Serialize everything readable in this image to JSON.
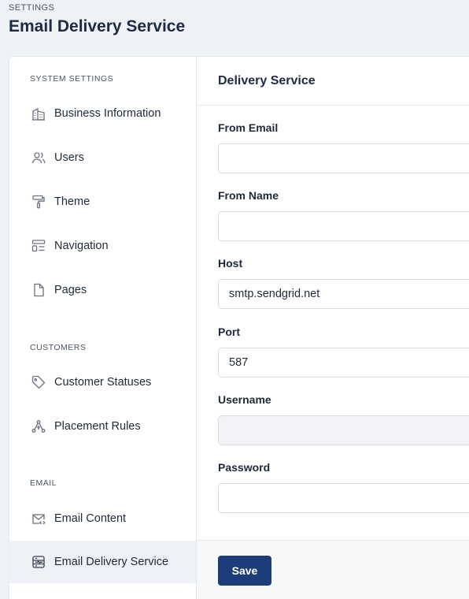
{
  "header": {
    "eyebrow": "SETTINGS",
    "title": "Email Delivery Service"
  },
  "sidebar": {
    "sections": [
      {
        "title": "SYSTEM SETTINGS",
        "items": [
          {
            "label": "Business Information",
            "icon": "building-icon"
          },
          {
            "label": "Users",
            "icon": "users-icon"
          },
          {
            "label": "Theme",
            "icon": "paint-roller-icon"
          },
          {
            "label": "Navigation",
            "icon": "layout-icon"
          },
          {
            "label": "Pages",
            "icon": "file-icon"
          }
        ]
      },
      {
        "title": "CUSTOMERS",
        "items": [
          {
            "label": "Customer Statuses",
            "icon": "tag-icon"
          },
          {
            "label": "Placement Rules",
            "icon": "network-icon"
          }
        ]
      },
      {
        "title": "EMAIL",
        "items": [
          {
            "label": "Email Content",
            "icon": "mail-code-icon"
          },
          {
            "label": "Email Delivery Service",
            "icon": "server-icon",
            "active": true
          }
        ]
      }
    ]
  },
  "main": {
    "section_title": "Delivery Service",
    "fields": {
      "from_email": {
        "label": "From Email",
        "value": ""
      },
      "from_name": {
        "label": "From Name",
        "value": ""
      },
      "host": {
        "label": "Host",
        "value": "smtp.sendgrid.net"
      },
      "port": {
        "label": "Port",
        "value": "587"
      },
      "username": {
        "label": "Username",
        "value": ""
      },
      "password": {
        "label": "Password",
        "value": ""
      }
    },
    "save_label": "Save"
  },
  "colors": {
    "accent": "#1c3c7a",
    "active_nav_bg": "#eef2f7",
    "page_bg": "#eef1f5"
  }
}
